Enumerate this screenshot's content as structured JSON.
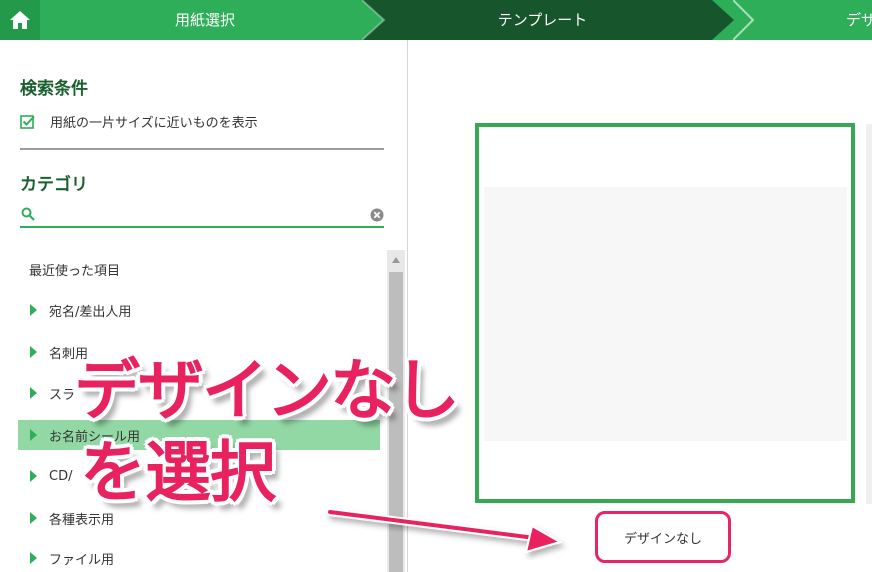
{
  "header": {
    "steps": [
      {
        "label": "用紙選択"
      },
      {
        "label": "テンプレート"
      },
      {
        "label": "デザ"
      }
    ],
    "colors": {
      "bar": "#2eae58",
      "active": "#17562d"
    }
  },
  "search": {
    "title": "検索条件",
    "checkbox_label": "用紙の一片サイズに近いものを表示",
    "checked": true
  },
  "category": {
    "title": "カテゴリ",
    "search_placeholder": "",
    "items": [
      {
        "label": "最近使った項目",
        "has_arrow": false
      },
      {
        "label": "宛名/差出人用",
        "has_arrow": true
      },
      {
        "label": "名刺用",
        "has_arrow": true
      },
      {
        "label": "スラ",
        "has_arrow": true
      },
      {
        "label": "お名前シール用",
        "has_arrow": true,
        "selected": true
      },
      {
        "label": "CD/",
        "has_arrow": true
      },
      {
        "label": "各種表示用",
        "has_arrow": true
      },
      {
        "label": "ファイル用",
        "has_arrow": true
      }
    ]
  },
  "template": {
    "label": "デザインなし"
  },
  "annotation": {
    "line1": "デザインなし",
    "line2": "を選択",
    "color": "#e8215f"
  }
}
